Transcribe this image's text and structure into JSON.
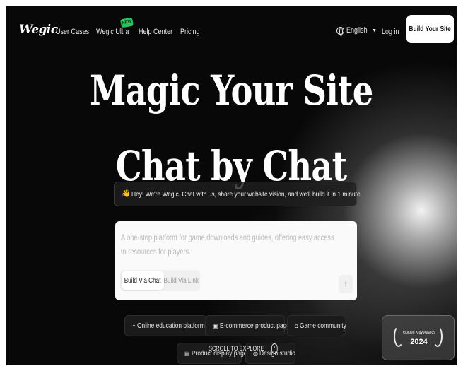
{
  "nav": {
    "logo": "Wegic",
    "links": [
      "User Cases",
      "Wegic Ultra",
      "Help Center",
      "Pricing"
    ],
    "new_badge": "NEW",
    "language": "English",
    "login": "Log in",
    "cta": "Build Your Site"
  },
  "hero": {
    "line1": "Magic Your Site",
    "line2": "Chat by Chat",
    "notice": "Hey! We're Wegic. Chat with us, share your website vision, and we'll build it in 1 minute."
  },
  "prompt_card": {
    "placeholder": "A one-stop platform for game downloads and guides, offering easy access to resources for players.",
    "modes": [
      "Build Via Chat",
      "Build Via Link"
    ],
    "active_mode": "Build Via Chat"
  },
  "suggestions": [
    {
      "icon": "graduation-cap-icon",
      "label": "Online education platform"
    },
    {
      "icon": "shopping-bag-icon",
      "label": "E-commerce product page"
    },
    {
      "icon": "gamepad-icon",
      "label": "Game community"
    },
    {
      "icon": "box-icon",
      "label": "Product display page"
    },
    {
      "icon": "palette-icon",
      "label": "Design studio"
    }
  ],
  "scroll_hint": "SCROLL TO EXPLORE",
  "award": {
    "title": "Golden Kitty Awards",
    "year": "2024"
  },
  "colors": {
    "background": "#080808",
    "cta_background": "#ffffff",
    "badge_green": "#22c55e"
  }
}
